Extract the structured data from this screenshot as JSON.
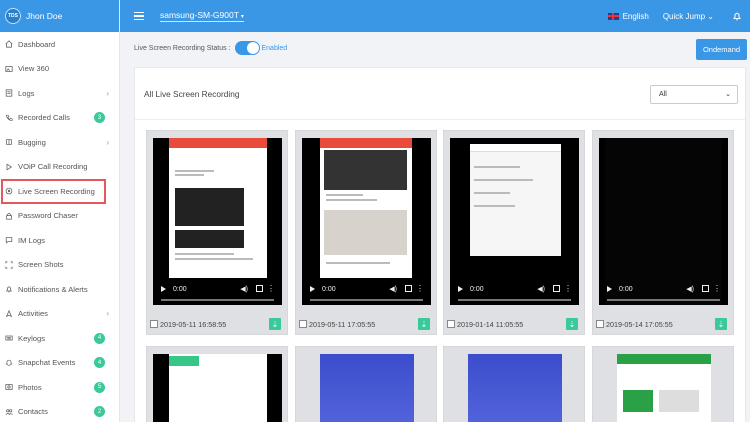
{
  "user": {
    "avatar_text": "TDS",
    "name": "Jhon Doe"
  },
  "sidebar": {
    "items": [
      {
        "label": "Dashboard",
        "icon": "home-icon"
      },
      {
        "label": "View 360",
        "icon": "image-icon"
      },
      {
        "label": "Logs",
        "icon": "logs-icon",
        "chevron": true
      },
      {
        "label": "Recorded Calls",
        "icon": "phone-icon",
        "badge": "3"
      },
      {
        "label": "Bugging",
        "icon": "bug-icon",
        "chevron": true
      },
      {
        "label": "VOiP Call Recording",
        "icon": "play-icon"
      },
      {
        "label": "Live Screen Recording",
        "icon": "record-icon",
        "active": true
      },
      {
        "label": "Password Chaser",
        "icon": "lock-icon"
      },
      {
        "label": "IM Logs",
        "icon": "chat-icon"
      },
      {
        "label": "Screen Shots",
        "icon": "screenshot-icon"
      },
      {
        "label": "Notifications & Alerts",
        "icon": "bell-icon"
      },
      {
        "label": "Activities",
        "icon": "activity-icon",
        "chevron": true
      },
      {
        "label": "Keylogs",
        "icon": "keyboard-icon",
        "badge": "4"
      },
      {
        "label": "Snapchat Events",
        "icon": "snapchat-icon",
        "badge": "4"
      },
      {
        "label": "Photos",
        "icon": "photo-icon",
        "badge": "5"
      },
      {
        "label": "Contacts",
        "icon": "contacts-icon",
        "badge": "2"
      }
    ]
  },
  "topbar": {
    "device": "samsung-SM-G900T",
    "language": "English",
    "quick_jump": "Quick Jump"
  },
  "status": {
    "label": "Live Screen Recording Status :",
    "state": "Enabled",
    "ondemand": "Ondemand"
  },
  "panel": {
    "title": "All Live Screen Recording",
    "filter_value": "All"
  },
  "player": {
    "time": "0:00"
  },
  "recordings": [
    {
      "date": "2019-05-11 16:58:55"
    },
    {
      "date": "2019-05-11 17:05:55"
    },
    {
      "date": "2019-01-14 11:05:55"
    },
    {
      "date": "2019-05-14 17:05:55"
    }
  ],
  "colors": {
    "accent": "#3a97e6",
    "badge": "#39c99a",
    "highlight": "#e4585b"
  }
}
